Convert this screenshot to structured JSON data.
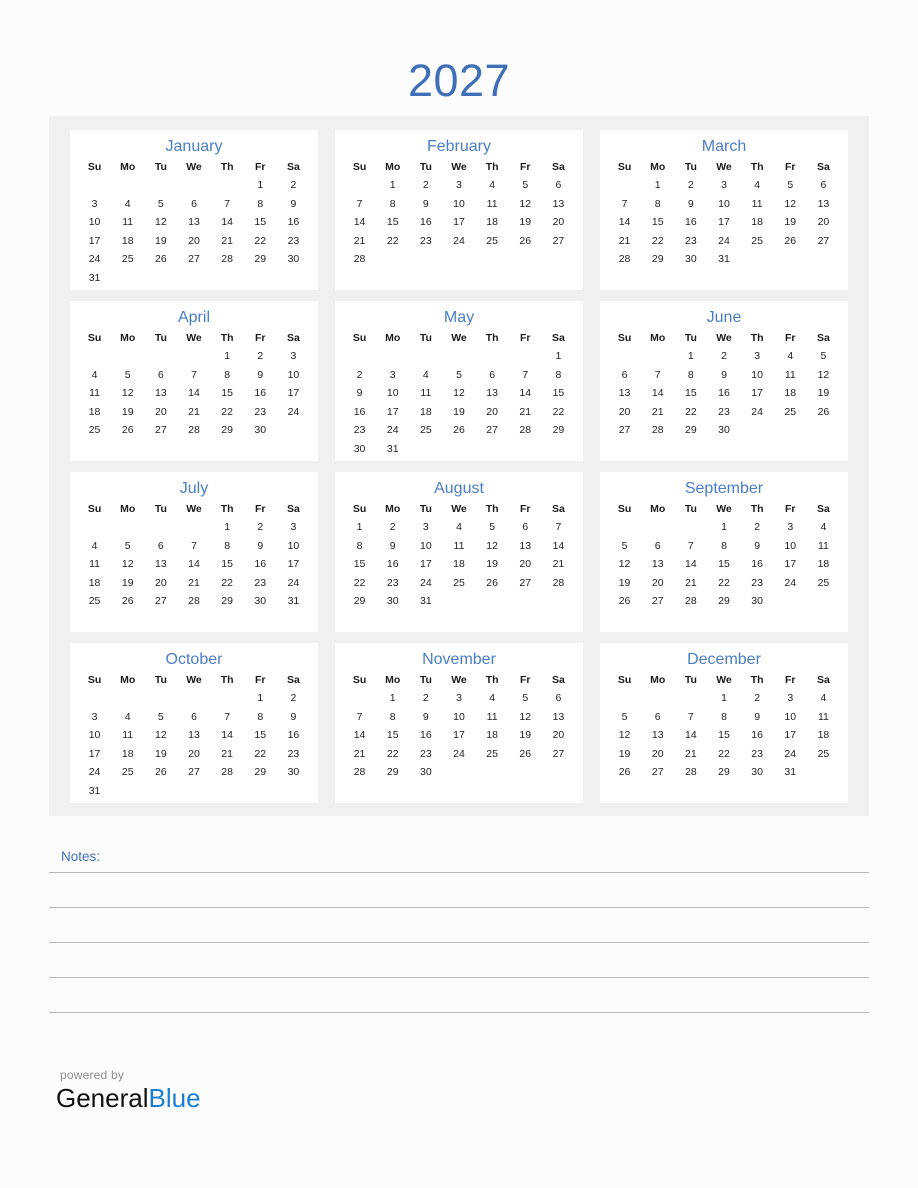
{
  "title": "2027",
  "weekday_headers": [
    "Su",
    "Mo",
    "Tu",
    "We",
    "Th",
    "Fr",
    "Sa"
  ],
  "colors": {
    "title_blue": "#3e6fb7",
    "month_name_blue": "#4a7ec4",
    "panel_grey": "#f0f0f1",
    "page_background": "#fcfcfc",
    "card_white": "#ffffff",
    "day_text": "#222222",
    "note_rule": "#b7b7b7",
    "powered_by_grey": "#8d8d8d",
    "brand_black": "#111111",
    "brand_blue": "#1a7fd4"
  },
  "months": [
    {
      "name": "January",
      "first_weekday_index": 5,
      "days_in_month": 31,
      "weeks": [
        [
          "",
          "",
          "",
          "",
          "",
          "1",
          "2"
        ],
        [
          "3",
          "4",
          "5",
          "6",
          "7",
          "8",
          "9"
        ],
        [
          "10",
          "11",
          "12",
          "13",
          "14",
          "15",
          "16"
        ],
        [
          "17",
          "18",
          "19",
          "20",
          "21",
          "22",
          "23"
        ],
        [
          "24",
          "25",
          "26",
          "27",
          "28",
          "29",
          "30"
        ],
        [
          "31",
          "",
          "",
          "",
          "",
          "",
          ""
        ]
      ]
    },
    {
      "name": "February",
      "first_weekday_index": 1,
      "days_in_month": 28,
      "weeks": [
        [
          "",
          "1",
          "2",
          "3",
          "4",
          "5",
          "6"
        ],
        [
          "7",
          "8",
          "9",
          "10",
          "11",
          "12",
          "13"
        ],
        [
          "14",
          "15",
          "16",
          "17",
          "18",
          "19",
          "20"
        ],
        [
          "21",
          "22",
          "23",
          "24",
          "25",
          "26",
          "27"
        ],
        [
          "28",
          "",
          "",
          "",
          "",
          "",
          ""
        ],
        [
          "",
          "",
          "",
          "",
          "",
          "",
          ""
        ]
      ]
    },
    {
      "name": "March",
      "first_weekday_index": 1,
      "days_in_month": 31,
      "weeks": [
        [
          "",
          "1",
          "2",
          "3",
          "4",
          "5",
          "6"
        ],
        [
          "7",
          "8",
          "9",
          "10",
          "11",
          "12",
          "13"
        ],
        [
          "14",
          "15",
          "16",
          "17",
          "18",
          "19",
          "20"
        ],
        [
          "21",
          "22",
          "23",
          "24",
          "25",
          "26",
          "27"
        ],
        [
          "28",
          "29",
          "30",
          "31",
          "",
          "",
          ""
        ],
        [
          "",
          "",
          "",
          "",
          "",
          "",
          ""
        ]
      ]
    },
    {
      "name": "April",
      "first_weekday_index": 4,
      "days_in_month": 30,
      "weeks": [
        [
          "",
          "",
          "",
          "",
          "1",
          "2",
          "3"
        ],
        [
          "4",
          "5",
          "6",
          "7",
          "8",
          "9",
          "10"
        ],
        [
          "11",
          "12",
          "13",
          "14",
          "15",
          "16",
          "17"
        ],
        [
          "18",
          "19",
          "20",
          "21",
          "22",
          "23",
          "24"
        ],
        [
          "25",
          "26",
          "27",
          "28",
          "29",
          "30",
          ""
        ],
        [
          "",
          "",
          "",
          "",
          "",
          "",
          ""
        ]
      ]
    },
    {
      "name": "May",
      "first_weekday_index": 6,
      "days_in_month": 31,
      "weeks": [
        [
          "",
          "",
          "",
          "",
          "",
          "",
          "1"
        ],
        [
          "2",
          "3",
          "4",
          "5",
          "6",
          "7",
          "8"
        ],
        [
          "9",
          "10",
          "11",
          "12",
          "13",
          "14",
          "15"
        ],
        [
          "16",
          "17",
          "18",
          "19",
          "20",
          "21",
          "22"
        ],
        [
          "23",
          "24",
          "25",
          "26",
          "27",
          "28",
          "29"
        ],
        [
          "30",
          "31",
          "",
          "",
          "",
          "",
          ""
        ]
      ]
    },
    {
      "name": "June",
      "first_weekday_index": 2,
      "days_in_month": 30,
      "weeks": [
        [
          "",
          "",
          "1",
          "2",
          "3",
          "4",
          "5"
        ],
        [
          "6",
          "7",
          "8",
          "9",
          "10",
          "11",
          "12"
        ],
        [
          "13",
          "14",
          "15",
          "16",
          "17",
          "18",
          "19"
        ],
        [
          "20",
          "21",
          "22",
          "23",
          "24",
          "25",
          "26"
        ],
        [
          "27",
          "28",
          "29",
          "30",
          "",
          "",
          ""
        ],
        [
          "",
          "",
          "",
          "",
          "",
          "",
          ""
        ]
      ]
    },
    {
      "name": "July",
      "first_weekday_index": 4,
      "days_in_month": 31,
      "weeks": [
        [
          "",
          "",
          "",
          "",
          "1",
          "2",
          "3"
        ],
        [
          "4",
          "5",
          "6",
          "7",
          "8",
          "9",
          "10"
        ],
        [
          "11",
          "12",
          "13",
          "14",
          "15",
          "16",
          "17"
        ],
        [
          "18",
          "19",
          "20",
          "21",
          "22",
          "23",
          "24"
        ],
        [
          "25",
          "26",
          "27",
          "28",
          "29",
          "30",
          "31"
        ],
        [
          "",
          "",
          "",
          "",
          "",
          "",
          ""
        ]
      ]
    },
    {
      "name": "August",
      "first_weekday_index": 0,
      "days_in_month": 31,
      "weeks": [
        [
          "1",
          "2",
          "3",
          "4",
          "5",
          "6",
          "7"
        ],
        [
          "8",
          "9",
          "10",
          "11",
          "12",
          "13",
          "14"
        ],
        [
          "15",
          "16",
          "17",
          "18",
          "19",
          "20",
          "21"
        ],
        [
          "22",
          "23",
          "24",
          "25",
          "26",
          "27",
          "28"
        ],
        [
          "29",
          "30",
          "31",
          "",
          "",
          "",
          ""
        ],
        [
          "",
          "",
          "",
          "",
          "",
          "",
          ""
        ]
      ]
    },
    {
      "name": "September",
      "first_weekday_index": 3,
      "days_in_month": 30,
      "weeks": [
        [
          "",
          "",
          "",
          "1",
          "2",
          "3",
          "4"
        ],
        [
          "5",
          "6",
          "7",
          "8",
          "9",
          "10",
          "11"
        ],
        [
          "12",
          "13",
          "14",
          "15",
          "16",
          "17",
          "18"
        ],
        [
          "19",
          "20",
          "21",
          "22",
          "23",
          "24",
          "25"
        ],
        [
          "26",
          "27",
          "28",
          "29",
          "30",
          "",
          ""
        ],
        [
          "",
          "",
          "",
          "",
          "",
          "",
          ""
        ]
      ]
    },
    {
      "name": "October",
      "first_weekday_index": 5,
      "days_in_month": 31,
      "weeks": [
        [
          "",
          "",
          "",
          "",
          "",
          "1",
          "2"
        ],
        [
          "3",
          "4",
          "5",
          "6",
          "7",
          "8",
          "9"
        ],
        [
          "10",
          "11",
          "12",
          "13",
          "14",
          "15",
          "16"
        ],
        [
          "17",
          "18",
          "19",
          "20",
          "21",
          "22",
          "23"
        ],
        [
          "24",
          "25",
          "26",
          "27",
          "28",
          "29",
          "30"
        ],
        [
          "31",
          "",
          "",
          "",
          "",
          "",
          ""
        ]
      ]
    },
    {
      "name": "November",
      "first_weekday_index": 1,
      "days_in_month": 30,
      "weeks": [
        [
          "",
          "1",
          "2",
          "3",
          "4",
          "5",
          "6"
        ],
        [
          "7",
          "8",
          "9",
          "10",
          "11",
          "12",
          "13"
        ],
        [
          "14",
          "15",
          "16",
          "17",
          "18",
          "19",
          "20"
        ],
        [
          "21",
          "22",
          "23",
          "24",
          "25",
          "26",
          "27"
        ],
        [
          "28",
          "29",
          "30",
          "",
          "",
          "",
          ""
        ],
        [
          "",
          "",
          "",
          "",
          "",
          "",
          ""
        ]
      ]
    },
    {
      "name": "December",
      "first_weekday_index": 3,
      "days_in_month": 31,
      "weeks": [
        [
          "",
          "",
          "",
          "1",
          "2",
          "3",
          "4"
        ],
        [
          "5",
          "6",
          "7",
          "8",
          "9",
          "10",
          "11"
        ],
        [
          "12",
          "13",
          "14",
          "15",
          "16",
          "17",
          "18"
        ],
        [
          "19",
          "20",
          "21",
          "22",
          "23",
          "24",
          "25"
        ],
        [
          "26",
          "27",
          "28",
          "29",
          "30",
          "31",
          ""
        ],
        [
          "",
          "",
          "",
          "",
          "",
          "",
          ""
        ]
      ]
    }
  ],
  "notes": {
    "label": "Notes:",
    "line_count": 5
  },
  "footer": {
    "powered_by": "powered by",
    "brand_part1": "General",
    "brand_part2": "Blue"
  }
}
